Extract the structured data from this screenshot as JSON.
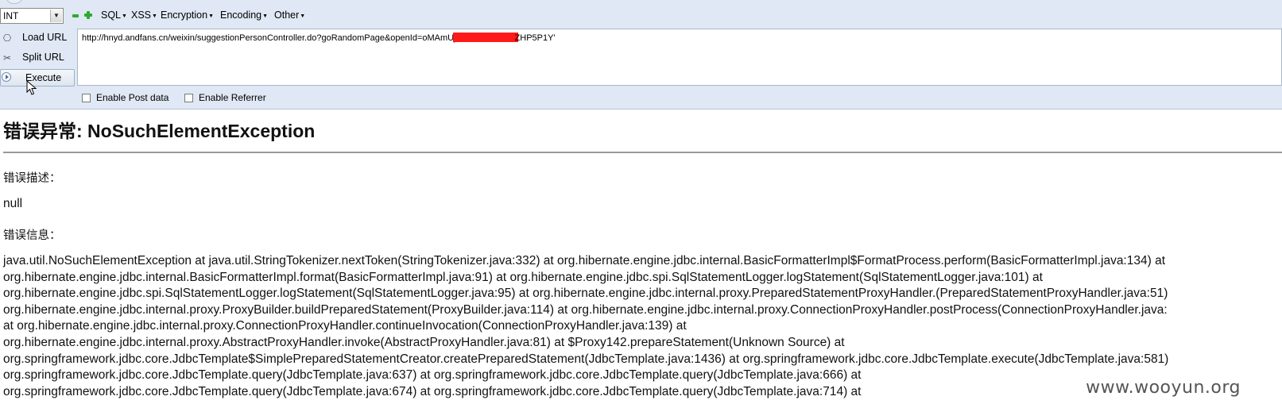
{
  "toolbar": {
    "select_value": "INT",
    "menus": [
      "SQL",
      "XSS",
      "Encryption",
      "Encoding",
      "Other"
    ],
    "buttons": {
      "load_url": "Load URL",
      "split_url": "Split URL",
      "execute": "Execute"
    },
    "url_before": "http://hnyd.andfans.cn/weixin/suggestionPersonController.do?goRandomPage&openId=oMAmUj",
    "url_after": "ZHP5P1Y'",
    "enable_post": "Enable Post data",
    "enable_referrer": "Enable Referrer"
  },
  "page": {
    "title": "错误异常: NoSuchElementException",
    "desc_label": "错误描述：",
    "desc_value": "null",
    "info_label": "错误信息：",
    "trace_lines": [
      "java.util.NoSuchElementException at java.util.StringTokenizer.nextToken(StringTokenizer.java:332) at org.hibernate.engine.jdbc.internal.BasicFormatterImpl$FormatProcess.perform(BasicFormatterImpl.java:134) at",
      "org.hibernate.engine.jdbc.internal.BasicFormatterImpl.format(BasicFormatterImpl.java:91) at org.hibernate.engine.jdbc.spi.SqlStatementLogger.logStatement(SqlStatementLogger.java:101) at",
      "org.hibernate.engine.jdbc.spi.SqlStatementLogger.logStatement(SqlStatementLogger.java:95) at org.hibernate.engine.jdbc.internal.proxy.PreparedStatementProxyHandler.(PreparedStatementProxyHandler.java:51)",
      "org.hibernate.engine.jdbc.internal.proxy.ProxyBuilder.buildPreparedStatement(ProxyBuilder.java:114) at org.hibernate.engine.jdbc.internal.proxy.ConnectionProxyHandler.postProcess(ConnectionProxyHandler.java:",
      "at org.hibernate.engine.jdbc.internal.proxy.ConnectionProxyHandler.continueInvocation(ConnectionProxyHandler.java:139) at",
      "org.hibernate.engine.jdbc.internal.proxy.AbstractProxyHandler.invoke(AbstractProxyHandler.java:81) at $Proxy142.prepareStatement(Unknown Source) at",
      "org.springframework.jdbc.core.JdbcTemplate$SimplePreparedStatementCreator.createPreparedStatement(JdbcTemplate.java:1436) at org.springframework.jdbc.core.JdbcTemplate.execute(JdbcTemplate.java:581)",
      "org.springframework.jdbc.core.JdbcTemplate.query(JdbcTemplate.java:637) at org.springframework.jdbc.core.JdbcTemplate.query(JdbcTemplate.java:666) at",
      "org.springframework.jdbc.core.JdbcTemplate.query(JdbcTemplate.java:674) at org.springframework.jdbc.core.JdbcTemplate.query(JdbcTemplate.java:714) at"
    ]
  },
  "watermark": "www.wooyun.org"
}
